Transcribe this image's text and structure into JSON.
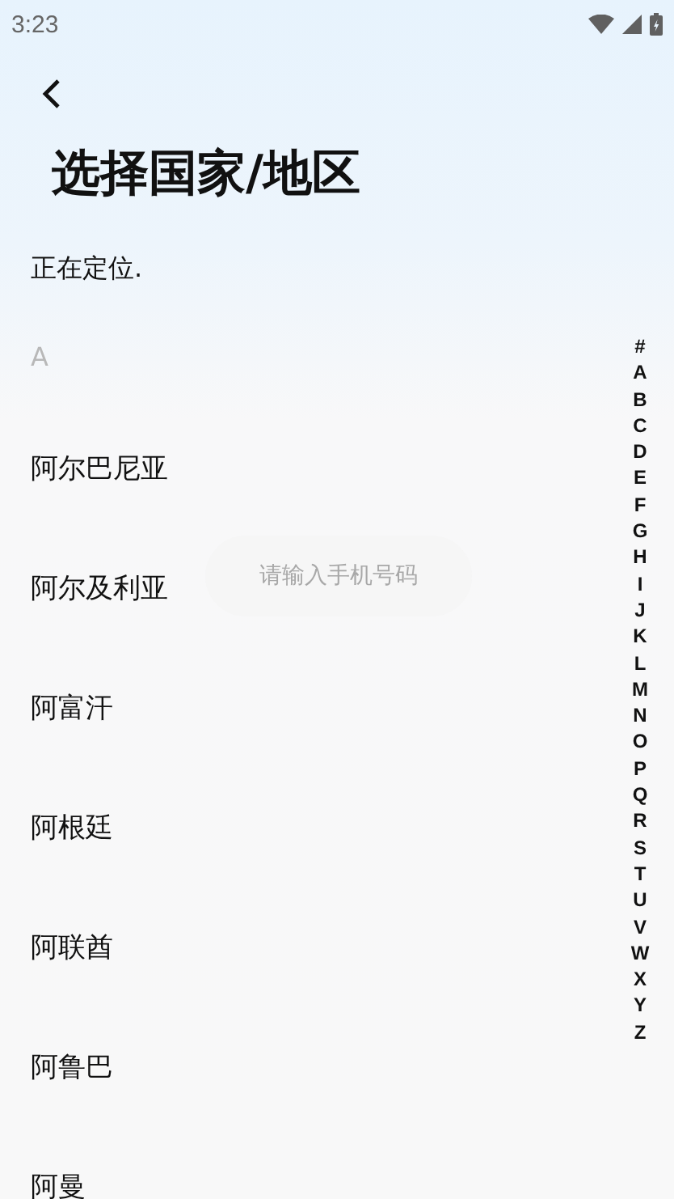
{
  "status_bar": {
    "time": "3:23"
  },
  "title": "选择国家/地区",
  "location_status": "正在定位.",
  "sections": [
    {
      "letter": "A",
      "countries": [
        "阿尔巴尼亚",
        "阿尔及利亚",
        "阿富汗",
        "阿根廷",
        "阿联酋",
        "阿鲁巴",
        "阿曼"
      ]
    }
  ],
  "index_letters": [
    "#",
    "A",
    "B",
    "C",
    "D",
    "E",
    "F",
    "G",
    "H",
    "I",
    "J",
    "K",
    "L",
    "M",
    "N",
    "O",
    "P",
    "Q",
    "R",
    "S",
    "T",
    "U",
    "V",
    "W",
    "X",
    "Y",
    "Z"
  ],
  "toast": {
    "text": "请输入手机号码"
  }
}
